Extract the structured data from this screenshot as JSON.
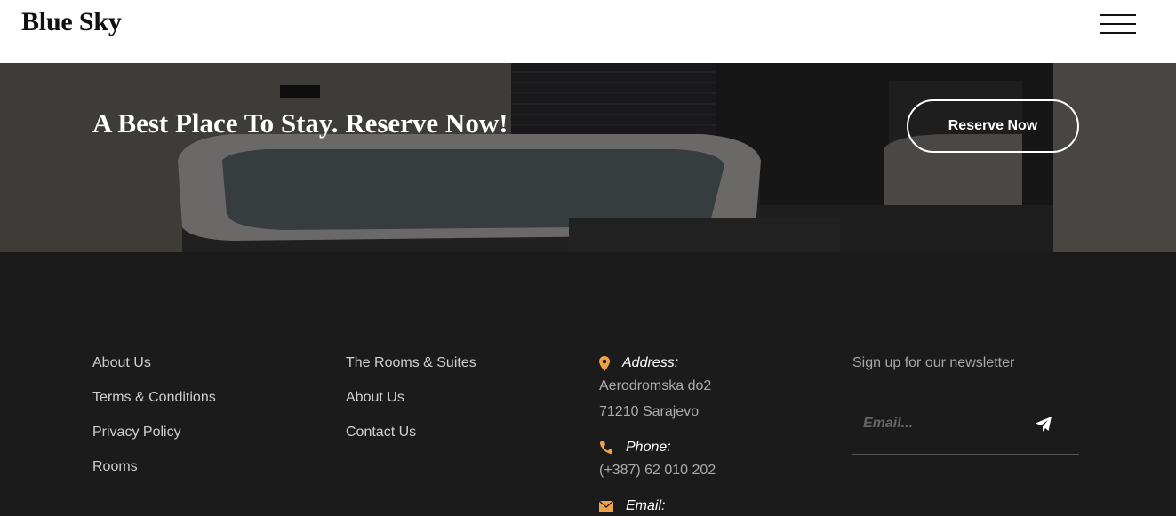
{
  "header": {
    "brand": "Blue Sky",
    "menu_icon": "hamburger-menu-icon"
  },
  "hero": {
    "title": "A Best Place To Stay. Reserve Now!",
    "reserve_label": "Reserve Now"
  },
  "footer": {
    "links_col1": [
      "About Us",
      "Terms & Conditions",
      "Privacy Policy",
      "Rooms"
    ],
    "links_col2": [
      "The Rooms & Suites",
      "About Us",
      "Contact Us"
    ],
    "contact": {
      "address_label": "Address:",
      "address_line1": "Aerodromska do2",
      "address_line2": "71210 Sarajevo",
      "phone_label": "Phone:",
      "phone_value": "(+387) 62 010 202",
      "email_label": "Email:"
    },
    "newsletter": {
      "title": "Sign up for our newsletter",
      "placeholder": "Email..."
    }
  },
  "colors": {
    "accent": "#f0a24a",
    "footer_bg": "#1b1b1b",
    "header_bg": "#ffffff"
  }
}
